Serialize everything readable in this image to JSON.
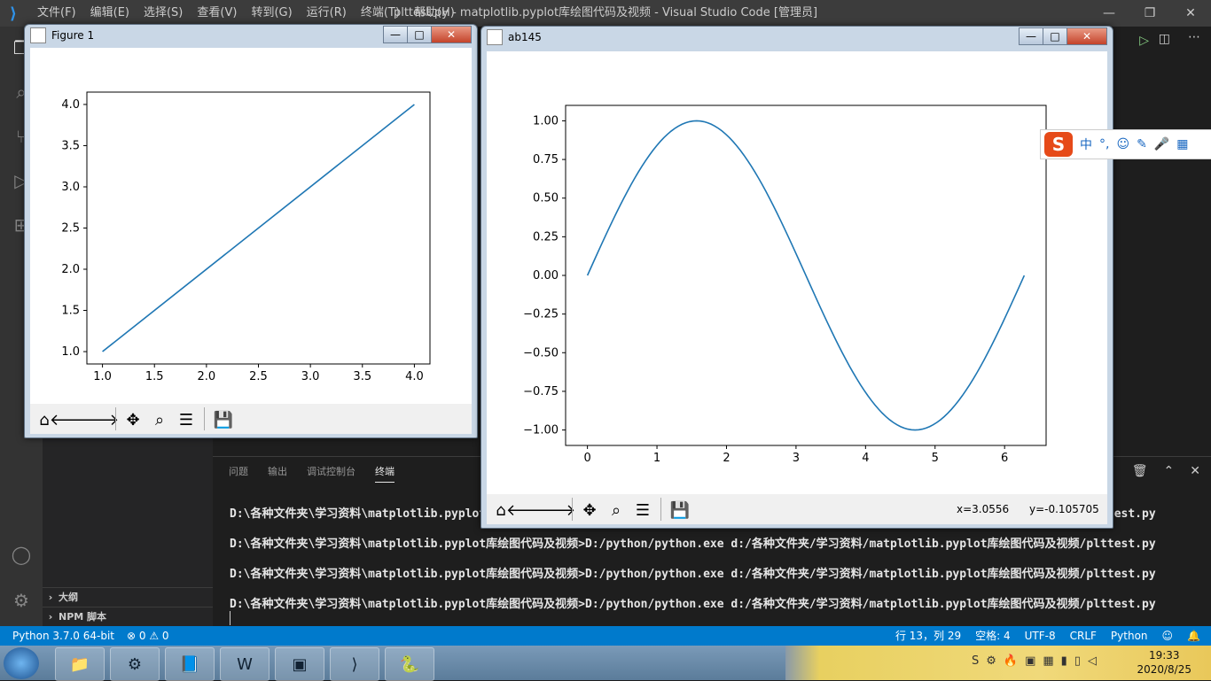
{
  "vscode": {
    "title": "plttest.py - matplotlib.pyplot库绘图代码及视频 - Visual Studio Code [管理员]",
    "menu": [
      "文件(F)",
      "编辑(E)",
      "选择(S)",
      "查看(V)",
      "转到(G)",
      "运行(R)",
      "终端(T)",
      "帮助(H)"
    ]
  },
  "sidebar": {
    "sections": [
      "大纲",
      "NPM 脚本"
    ]
  },
  "panel": {
    "tabs": [
      "问题",
      "输出",
      "调试控制台",
      "终端"
    ],
    "active_tab": "终端",
    "lines": [
      "D:\\各种文件夹\\学习资料\\matplotlib.pyplot库绘图代码及视频>D:/python/python.exe d:/各种文件夹/学习资料/matplotlib.pyplot库绘图代码及视频/plttest.py",
      "D:\\各种文件夹\\学习资料\\matplotlib.pyplot库绘图代码及视频>D:/python/python.exe d:/各种文件夹/学习资料/matplotlib.pyplot库绘图代码及视频/plttest.py",
      "D:\\各种文件夹\\学习资料\\matplotlib.pyplot库绘图代码及视频>D:/python/python.exe d:/各种文件夹/学习资料/matplotlib.pyplot库绘图代码及视频/plttest.py",
      "D:\\各种文件夹\\学习资料\\matplotlib.pyplot库绘图代码及视频>D:/python/python.exe d:/各种文件夹/学习资料/matplotlib.pyplot库绘图代码及视频/plttest.py"
    ]
  },
  "statusbar": {
    "interpreter": "Python 3.7.0 64-bit",
    "problems": "⊗ 0 ⚠ 0",
    "position": "行 13，列 29",
    "spaces": "空格: 4",
    "encoding": "UTF-8",
    "eol": "CRLF",
    "language": "Python"
  },
  "taskbar": {
    "time": "19:33",
    "date": "2020/8/25"
  },
  "figure1": {
    "title": "Figure 1"
  },
  "figure2": {
    "title": "ab145",
    "coords_x": "x=3.0556",
    "coords_y": "y=-0.105705"
  },
  "ime": {
    "mode": "中"
  },
  "chart_data": [
    {
      "type": "line",
      "x": [
        1,
        4
      ],
      "y": [
        1,
        4
      ],
      "xlim": [
        0.85,
        4.15
      ],
      "ylim": [
        0.85,
        4.15
      ],
      "xticks": [
        "1.0",
        "1.5",
        "2.0",
        "2.5",
        "3.0",
        "3.5",
        "4.0"
      ],
      "yticks": [
        "1.0",
        "1.5",
        "2.0",
        "2.5",
        "3.0",
        "3.5",
        "4.0"
      ],
      "color": "#1f77b4",
      "grid": false
    },
    {
      "type": "line",
      "function": "sin(x)",
      "x_range": [
        0,
        6.283
      ],
      "xlim": [
        -0.314,
        6.597
      ],
      "ylim": [
        -1.1,
        1.1
      ],
      "xticks": [
        "0",
        "1",
        "2",
        "3",
        "4",
        "5",
        "6"
      ],
      "yticks": [
        "1.00",
        "0.75",
        "0.50",
        "0.25",
        "0.00",
        "−0.25",
        "−0.50",
        "−0.75",
        "−1.00"
      ],
      "color": "#1f77b4",
      "grid": false
    }
  ]
}
